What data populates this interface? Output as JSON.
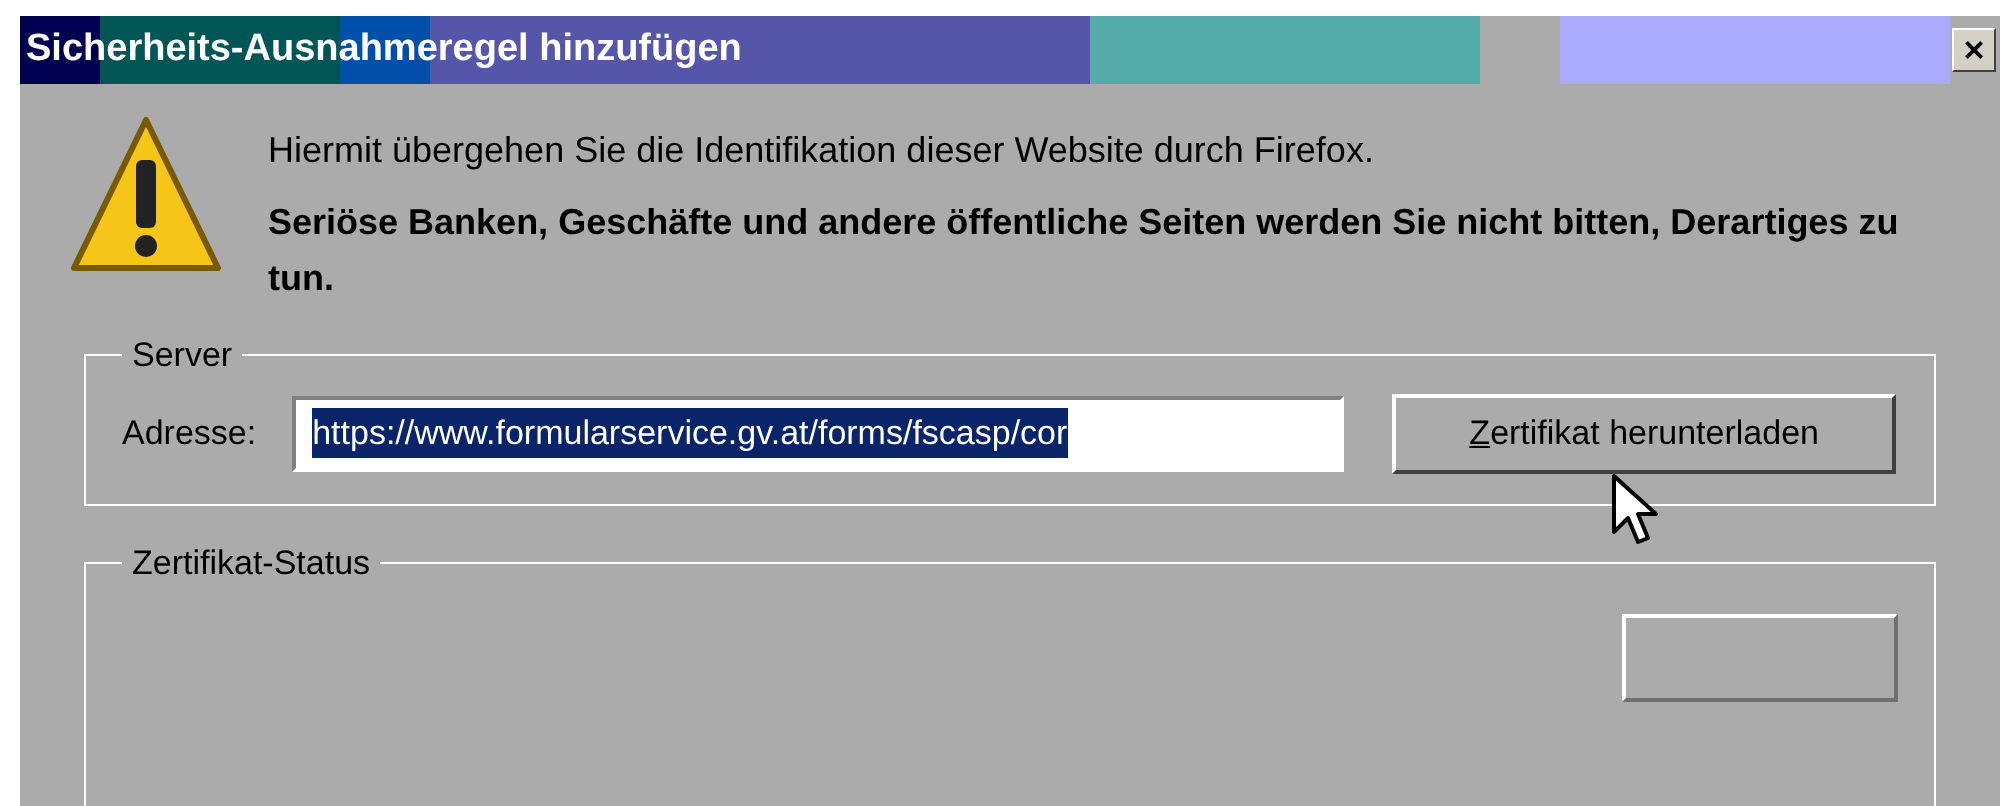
{
  "window": {
    "title": "Sicherheits-Ausnahmeregel hinzufügen",
    "close": "×"
  },
  "message": {
    "intro": "Hiermit übergehen Sie die Identifikation dieser Website durch Firefox.",
    "warning": "Seriöse Banken, Geschäfte und andere öffentliche Seiten werden Sie nicht bitten, Derartiges zu tun."
  },
  "server": {
    "legend": "Server",
    "address_label": "Adresse:",
    "address_value": "https://www.formularservice.gv.at/forms/fscasp/cor",
    "address_selected": true,
    "download_button": "Zertifikat herunterladen"
  },
  "status": {
    "legend": "Zertifikat-Status",
    "button_disabled": true
  }
}
